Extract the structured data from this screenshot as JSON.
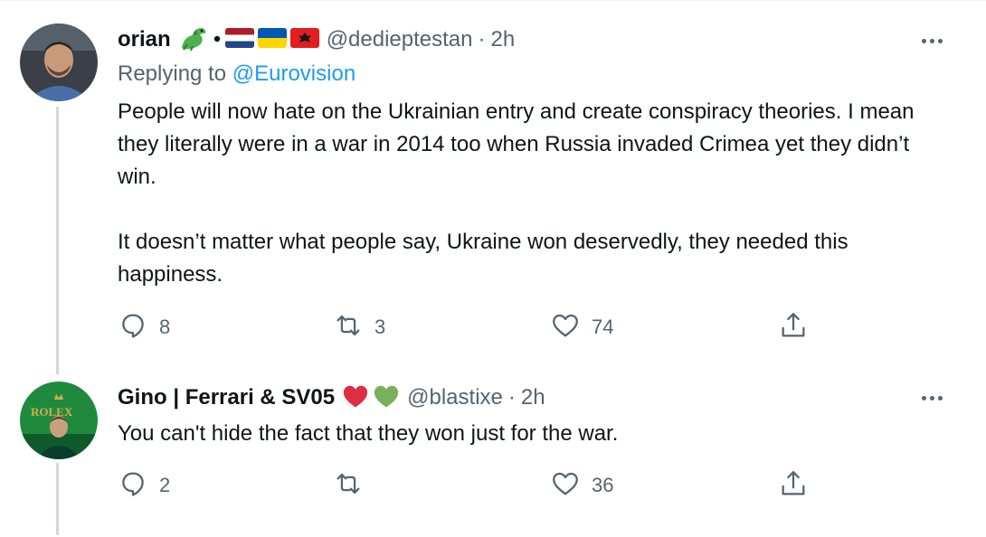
{
  "tweets": [
    {
      "name": "orian",
      "handle": "@dedieptestan",
      "separator": "·",
      "time": "2h",
      "replying_prefix": "Replying to ",
      "replying_to": "@Eurovision",
      "paragraphs": [
        "People will now hate on the Ukrainian entry and create conspiracy theories. I mean they literally were in a war in 2014 too when Russia invaded Crimea yet they didn’t win.",
        "It doesn’t matter what people say, Ukraine won deservedly, they needed this happiness."
      ],
      "name_icons": [
        "dragon-emoji",
        "bullet",
        "netherlands-flag",
        "ukraine-flag",
        "albania-flag"
      ],
      "counts": {
        "replies": "8",
        "retweets": "3",
        "likes": "74"
      }
    },
    {
      "name": "Gino | Ferrari & SV05",
      "handle": "@blastixe",
      "separator": "·",
      "time": "2h",
      "paragraphs": [
        "You can't hide the fact that they won just for the war."
      ],
      "name_icons": [
        "red-heart-emoji",
        "green-heart-emoji"
      ],
      "counts": {
        "replies": "2",
        "likes": "36"
      }
    }
  ],
  "colors": {
    "text": "#0f1419",
    "secondary": "#536471",
    "link": "#1d9bf0",
    "thread_line": "#cfd9de"
  },
  "icons": [
    "reply-icon",
    "retweet-icon",
    "like-icon",
    "share-icon",
    "more-icon"
  ]
}
